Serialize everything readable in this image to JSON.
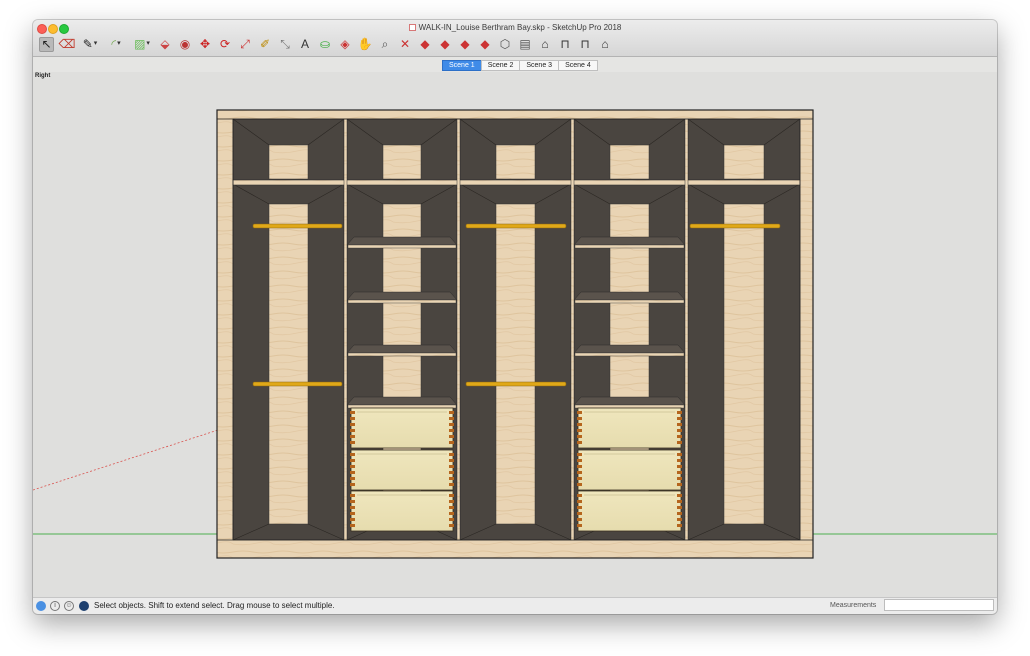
{
  "window": {
    "title": "WALK-IN_Louise Berthram Bay.skp - SketchUp Pro 2018"
  },
  "toolbar": {
    "tools": [
      {
        "name": "select-tool-icon",
        "glyph": "↖"
      },
      {
        "name": "eraser-tool-icon",
        "glyph": "⌫"
      },
      {
        "name": "line-tool-icon",
        "glyph": "✎"
      },
      {
        "name": "arc-tool-icon",
        "glyph": "◜"
      },
      {
        "name": "rectangle-tool-icon",
        "glyph": "▨"
      },
      {
        "name": "push-pull-tool-icon",
        "glyph": "⬙"
      },
      {
        "name": "offset-tool-icon",
        "glyph": "◉"
      },
      {
        "name": "move-tool-icon",
        "glyph": "✥"
      },
      {
        "name": "rotate-tool-icon",
        "glyph": "⟳"
      },
      {
        "name": "scale-tool-icon",
        "glyph": "⤢"
      },
      {
        "name": "tape-measure-tool-icon",
        "glyph": "✐"
      },
      {
        "name": "dimension-tool-icon",
        "glyph": "⤡"
      },
      {
        "name": "text-tool-icon",
        "glyph": "A"
      },
      {
        "name": "paint-bucket-tool-icon",
        "glyph": "⛀"
      },
      {
        "name": "orbit-tool-icon",
        "glyph": "◈"
      },
      {
        "name": "pan-tool-icon",
        "glyph": "✋"
      },
      {
        "name": "zoom-tool-icon",
        "glyph": "⌕"
      },
      {
        "name": "zoom-extents-tool-icon",
        "glyph": "✕"
      },
      {
        "name": "warehouse-icon",
        "glyph": "◆"
      },
      {
        "name": "share-model-icon",
        "glyph": "◆"
      },
      {
        "name": "extension-warehouse-icon",
        "glyph": "◆"
      },
      {
        "name": "ruby-console-icon",
        "glyph": "◆"
      },
      {
        "name": "iso-view-icon",
        "glyph": "⬡"
      },
      {
        "name": "top-view-icon",
        "glyph": "▤"
      },
      {
        "name": "front-view-icon",
        "glyph": "⌂"
      },
      {
        "name": "right-view-icon",
        "glyph": "⊓"
      },
      {
        "name": "back-view-icon",
        "glyph": "⊓"
      },
      {
        "name": "left-view-icon",
        "glyph": "⌂"
      }
    ]
  },
  "scenes": [
    "Scene 1",
    "Scene 2",
    "Scene 3",
    "Scene 4"
  ],
  "active_scene": "Scene 1",
  "viewport": {
    "view_label": "Right"
  },
  "status": {
    "message": "Select objects. Shift to extend select. Drag mouse to select multiple.",
    "measurements_label": "Measurements",
    "measurements_value": ""
  },
  "colors": {
    "wood_light": "#e9d4b4",
    "wood_grain": "#d7b98e",
    "carcass_dark": "#4a4540",
    "rail_gold": "#e0a818",
    "drawer_front": "#e6dcae",
    "axis_green": "#4caf50",
    "axis_red": "#d9534f"
  }
}
